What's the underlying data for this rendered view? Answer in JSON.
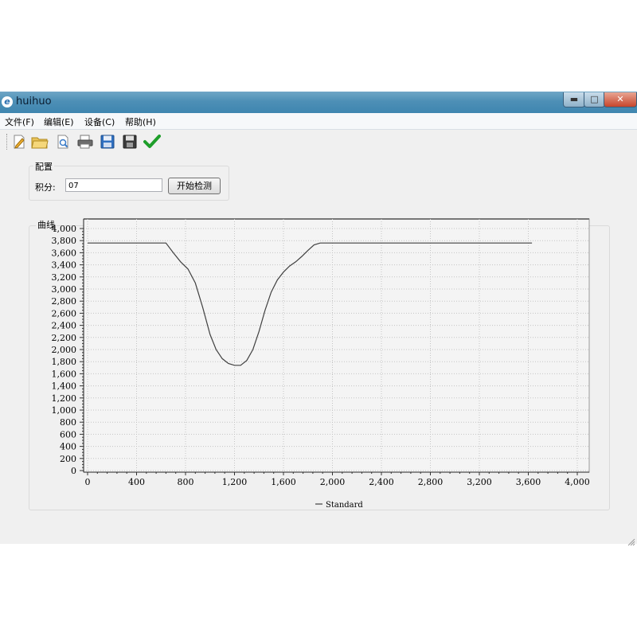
{
  "window": {
    "title": "huihuo",
    "controls": {
      "minimize": "▬",
      "maximize": "□",
      "close": "✕"
    }
  },
  "menu": [
    "文件(F)",
    "编辑(E)",
    "设备(C)",
    "帮助(H)"
  ],
  "toolbar": {
    "icons": [
      "new-icon",
      "open-folder-icon",
      "preview-icon",
      "print-icon",
      "save-icon",
      "save-as-icon",
      "check-icon"
    ]
  },
  "config": {
    "title": "配置",
    "integral_label": "积分:",
    "integral_value": "07",
    "start_button": "开始检测"
  },
  "curve": {
    "title": "曲线"
  },
  "chart_data": {
    "type": "line",
    "title": "",
    "xlabel": "",
    "ylabel": "",
    "xlim": [
      0,
      4000
    ],
    "ylim": [
      0,
      4000
    ],
    "x_ticks": [
      0,
      400,
      800,
      1200,
      1600,
      2000,
      2400,
      2800,
      3200,
      3600,
      4000
    ],
    "x_tick_labels": [
      "0",
      "400",
      "800",
      "1,200",
      "1,600",
      "2,000",
      "2,400",
      "2,800",
      "3,200",
      "3,600",
      "4,000"
    ],
    "y_ticks": [
      0,
      200,
      400,
      600,
      800,
      1000,
      1200,
      1400,
      1600,
      1800,
      2000,
      2200,
      2400,
      2600,
      2800,
      3000,
      3200,
      3400,
      3600,
      3800,
      4000
    ],
    "y_tick_labels": [
      "0",
      "200",
      "400",
      "600",
      "800",
      "1,000",
      "1,200",
      "1,400",
      "1,600",
      "1,800",
      "2,000",
      "2,200",
      "2,400",
      "2,600",
      "2,800",
      "3,000",
      "3,200",
      "3,400",
      "3,600",
      "3,800",
      "4,000"
    ],
    "grid": true,
    "legend": "bottom-center",
    "series": [
      {
        "name": "Standard",
        "color": "#404040",
        "x": [
          0,
          640,
          700,
          760,
          820,
          880,
          940,
          1000,
          1050,
          1100,
          1150,
          1200,
          1250,
          1300,
          1350,
          1400,
          1450,
          1500,
          1550,
          1600,
          1650,
          1700,
          1750,
          1800,
          1850,
          1900,
          3630
        ],
        "y": [
          3760,
          3760,
          3600,
          3450,
          3330,
          3100,
          2700,
          2250,
          2000,
          1850,
          1770,
          1740,
          1740,
          1820,
          2000,
          2300,
          2650,
          2950,
          3150,
          3280,
          3380,
          3450,
          3540,
          3640,
          3730,
          3760,
          3760
        ]
      }
    ]
  }
}
